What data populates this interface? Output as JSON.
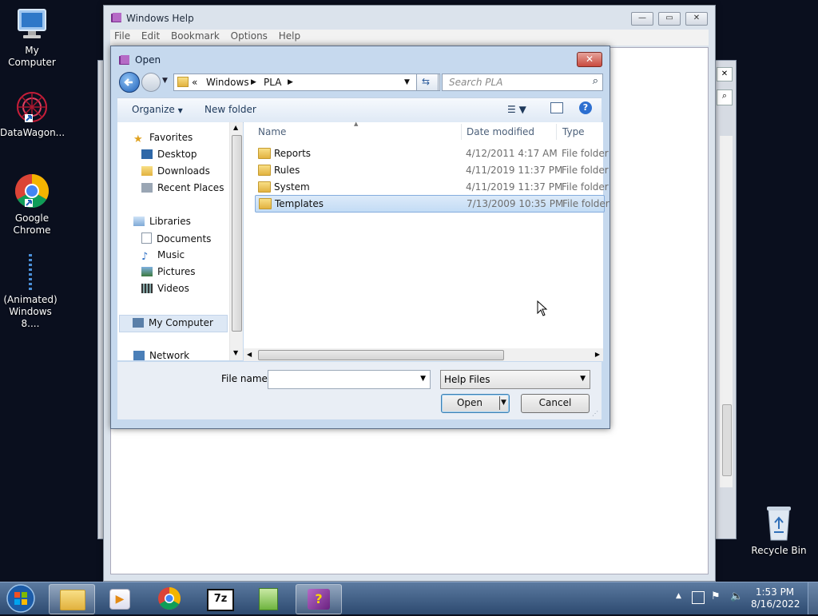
{
  "desktop": {
    "icons": [
      {
        "label": "My Computer",
        "icon": "computer-icon"
      },
      {
        "label": "DataWagon...",
        "icon": "datawagon-icon"
      },
      {
        "label": "Google Chrome",
        "icon": "chrome-icon"
      },
      {
        "label": "(Animated) Windows 8....",
        "icon": "animated-bar-icon"
      },
      {
        "label": "Recycle Bin",
        "icon": "recycle-bin-icon"
      }
    ]
  },
  "help_window": {
    "title": "Windows Help",
    "menu": [
      "File",
      "Edit",
      "Bookmark",
      "Options",
      "Help"
    ]
  },
  "open_dialog": {
    "title": "Open",
    "breadcrumb": [
      "«",
      "Windows",
      "PLA"
    ],
    "search_placeholder": "Search PLA",
    "toolbar": {
      "organize": "Organize",
      "new_folder": "New folder"
    },
    "nav": {
      "favorites": {
        "label": "Favorites",
        "items": [
          "Desktop",
          "Downloads",
          "Recent Places"
        ]
      },
      "libraries": {
        "label": "Libraries",
        "items": [
          "Documents",
          "Music",
          "Pictures",
          "Videos"
        ]
      },
      "computer": "My Computer",
      "network": "Network"
    },
    "columns": {
      "name": "Name",
      "date": "Date modified",
      "type": "Type"
    },
    "files": [
      {
        "name": "Reports",
        "date": "4/12/2011 4:17 AM",
        "type": "File folder",
        "selected": false
      },
      {
        "name": "Rules",
        "date": "4/11/2019 11:37 PM",
        "type": "File folder",
        "selected": false
      },
      {
        "name": "System",
        "date": "4/11/2019 11:37 PM",
        "type": "File folder",
        "selected": false
      },
      {
        "name": "Templates",
        "date": "7/13/2009 10:35 PM",
        "type": "File folder",
        "selected": true
      }
    ],
    "filename_label": "File name:",
    "filename_value": "",
    "filter_value": "Help Files",
    "open_label": "Open",
    "cancel_label": "Cancel"
  },
  "taskbar": {
    "items": [
      "start-orb-icon",
      "explorer-icon",
      "media-player-icon",
      "chrome-icon",
      "7zip-icon",
      "notepad-icon",
      "help-icon"
    ],
    "time": "1:53 PM",
    "date": "8/16/2022"
  },
  "colors": {
    "accent": "#2a6fd1",
    "selection": "#cce4f7",
    "taskbar": "#3a5a82"
  }
}
